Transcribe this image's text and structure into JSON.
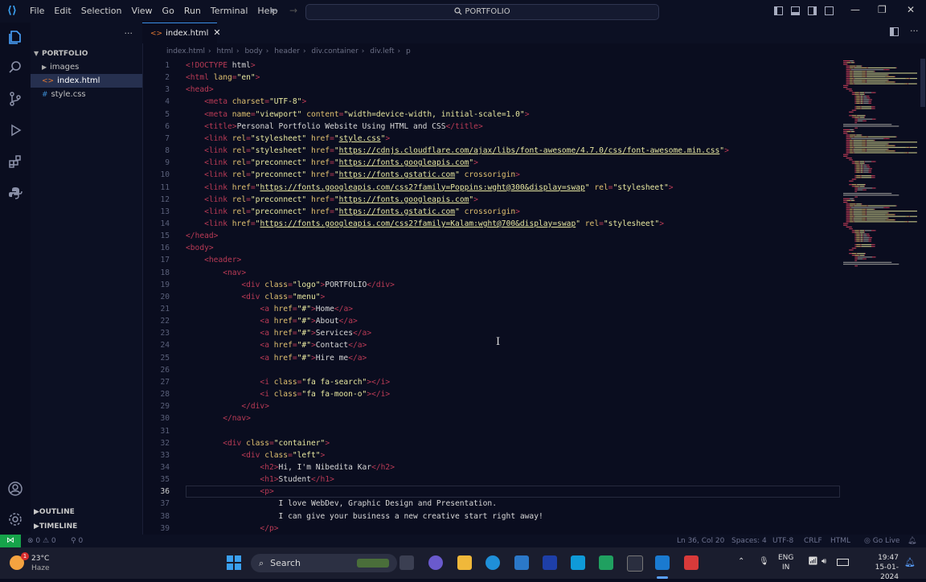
{
  "title_bar": {
    "menu": [
      "File",
      "Edit",
      "Selection",
      "View",
      "Go",
      "Run",
      "Terminal",
      "Help"
    ],
    "command_center": "PORTFOLIO"
  },
  "sidebar": {
    "explorer_root": "PORTFOLIO",
    "items": [
      {
        "label": "images",
        "type": "folder"
      },
      {
        "label": "index.html",
        "type": "html"
      },
      {
        "label": "style.css",
        "type": "css"
      }
    ],
    "outline": "OUTLINE",
    "timeline": "TIMELINE"
  },
  "editor": {
    "tab": "index.html",
    "breadcrumbs": [
      "index.html",
      "html",
      "body",
      "header",
      "div.container",
      "div.left",
      "p"
    ],
    "current_line": 36,
    "lines": [
      [
        [
          "t",
          "<!"
        ],
        [
          "k",
          "DOCTYPE"
        ],
        [
          "x",
          " html"
        ],
        [
          "t",
          ">"
        ]
      ],
      [
        [
          "t",
          "<"
        ],
        [
          "k",
          "html"
        ],
        [
          "a",
          " lang"
        ],
        [
          "t",
          "="
        ],
        [
          "v",
          "\"en\""
        ],
        [
          "t",
          ">"
        ]
      ],
      [
        [
          "t",
          "<"
        ],
        [
          "k",
          "head"
        ],
        [
          "t",
          ">"
        ]
      ],
      [
        [
          "x",
          "    "
        ],
        [
          "t",
          "<"
        ],
        [
          "k",
          "meta"
        ],
        [
          "a",
          " charset"
        ],
        [
          "t",
          "="
        ],
        [
          "v",
          "\"UTF-8\""
        ],
        [
          "t",
          ">"
        ]
      ],
      [
        [
          "x",
          "    "
        ],
        [
          "t",
          "<"
        ],
        [
          "k",
          "meta"
        ],
        [
          "a",
          " name"
        ],
        [
          "t",
          "="
        ],
        [
          "v",
          "\"viewport\""
        ],
        [
          "a",
          " content"
        ],
        [
          "t",
          "="
        ],
        [
          "v",
          "\"width=device-width, initial-scale=1.0\""
        ],
        [
          "t",
          ">"
        ]
      ],
      [
        [
          "x",
          "    "
        ],
        [
          "t",
          "<"
        ],
        [
          "k",
          "title"
        ],
        [
          "t",
          ">"
        ],
        [
          "x",
          "Personal Portfolio Website Using HTML and CSS"
        ],
        [
          "t",
          "</"
        ],
        [
          "k",
          "title"
        ],
        [
          "t",
          ">"
        ]
      ],
      [
        [
          "x",
          "    "
        ],
        [
          "t",
          "<"
        ],
        [
          "k",
          "link"
        ],
        [
          "a",
          " rel"
        ],
        [
          "t",
          "="
        ],
        [
          "v",
          "\"stylesheet\""
        ],
        [
          "a",
          " href"
        ],
        [
          "t",
          "="
        ],
        [
          "v",
          "\""
        ],
        [
          "l",
          "style.css"
        ],
        [
          "v",
          "\""
        ],
        [
          "t",
          ">"
        ]
      ],
      [
        [
          "x",
          "    "
        ],
        [
          "t",
          "<"
        ],
        [
          "k",
          "link"
        ],
        [
          "a",
          " rel"
        ],
        [
          "t",
          "="
        ],
        [
          "v",
          "\"stylesheet\""
        ],
        [
          "a",
          " href"
        ],
        [
          "t",
          "="
        ],
        [
          "v",
          "\""
        ],
        [
          "l",
          "https://cdnjs.cloudflare.com/ajax/libs/font-awesome/4.7.0/css/font-awesome.min.css"
        ],
        [
          "v",
          "\""
        ],
        [
          "t",
          ">"
        ]
      ],
      [
        [
          "x",
          "    "
        ],
        [
          "t",
          "<"
        ],
        [
          "k",
          "link"
        ],
        [
          "a",
          " rel"
        ],
        [
          "t",
          "="
        ],
        [
          "v",
          "\"preconnect\""
        ],
        [
          "a",
          " href"
        ],
        [
          "t",
          "="
        ],
        [
          "v",
          "\""
        ],
        [
          "l",
          "https://fonts.googleapis.com"
        ],
        [
          "v",
          "\""
        ],
        [
          "t",
          ">"
        ]
      ],
      [
        [
          "x",
          "    "
        ],
        [
          "t",
          "<"
        ],
        [
          "k",
          "link"
        ],
        [
          "a",
          " rel"
        ],
        [
          "t",
          "="
        ],
        [
          "v",
          "\"preconnect\""
        ],
        [
          "a",
          " href"
        ],
        [
          "t",
          "="
        ],
        [
          "v",
          "\""
        ],
        [
          "l",
          "https://fonts.gstatic.com"
        ],
        [
          "v",
          "\""
        ],
        [
          "a",
          " crossorigin"
        ],
        [
          "t",
          ">"
        ]
      ],
      [
        [
          "x",
          "    "
        ],
        [
          "t",
          "<"
        ],
        [
          "k",
          "link"
        ],
        [
          "a",
          " href"
        ],
        [
          "t",
          "="
        ],
        [
          "v",
          "\""
        ],
        [
          "l",
          "https://fonts.googleapis.com/css2?family=Poppins:wght@300&display=swap"
        ],
        [
          "v",
          "\""
        ],
        [
          "a",
          " rel"
        ],
        [
          "t",
          "="
        ],
        [
          "v",
          "\"stylesheet\""
        ],
        [
          "t",
          ">"
        ]
      ],
      [
        [
          "x",
          "    "
        ],
        [
          "t",
          "<"
        ],
        [
          "k",
          "link"
        ],
        [
          "a",
          " rel"
        ],
        [
          "t",
          "="
        ],
        [
          "v",
          "\"preconnect\""
        ],
        [
          "a",
          " href"
        ],
        [
          "t",
          "="
        ],
        [
          "v",
          "\""
        ],
        [
          "l",
          "https://fonts.googleapis.com"
        ],
        [
          "v",
          "\""
        ],
        [
          "t",
          ">"
        ]
      ],
      [
        [
          "x",
          "    "
        ],
        [
          "t",
          "<"
        ],
        [
          "k",
          "link"
        ],
        [
          "a",
          " rel"
        ],
        [
          "t",
          "="
        ],
        [
          "v",
          "\"preconnect\""
        ],
        [
          "a",
          " href"
        ],
        [
          "t",
          "="
        ],
        [
          "v",
          "\""
        ],
        [
          "l",
          "https://fonts.gstatic.com"
        ],
        [
          "v",
          "\""
        ],
        [
          "a",
          " crossorigin"
        ],
        [
          "t",
          ">"
        ]
      ],
      [
        [
          "x",
          "    "
        ],
        [
          "t",
          "<"
        ],
        [
          "k",
          "link"
        ],
        [
          "a",
          " href"
        ],
        [
          "t",
          "="
        ],
        [
          "v",
          "\""
        ],
        [
          "l",
          "https://fonts.googleapis.com/css2?family=Kalam:wght@700&display=swap"
        ],
        [
          "v",
          "\""
        ],
        [
          "a",
          " rel"
        ],
        [
          "t",
          "="
        ],
        [
          "v",
          "\"stylesheet\""
        ],
        [
          "t",
          ">"
        ]
      ],
      [
        [
          "t",
          "</"
        ],
        [
          "k",
          "head"
        ],
        [
          "t",
          ">"
        ]
      ],
      [
        [
          "t",
          "<"
        ],
        [
          "k",
          "body"
        ],
        [
          "t",
          ">"
        ]
      ],
      [
        [
          "x",
          "    "
        ],
        [
          "t",
          "<"
        ],
        [
          "k",
          "header"
        ],
        [
          "t",
          ">"
        ]
      ],
      [
        [
          "x",
          "        "
        ],
        [
          "t",
          "<"
        ],
        [
          "k",
          "nav"
        ],
        [
          "t",
          ">"
        ]
      ],
      [
        [
          "x",
          "            "
        ],
        [
          "t",
          "<"
        ],
        [
          "k",
          "div"
        ],
        [
          "a",
          " class"
        ],
        [
          "t",
          "="
        ],
        [
          "v",
          "\"logo\""
        ],
        [
          "t",
          ">"
        ],
        [
          "x",
          "PORTFOLIO"
        ],
        [
          "t",
          "</"
        ],
        [
          "k",
          "div"
        ],
        [
          "t",
          ">"
        ]
      ],
      [
        [
          "x",
          "            "
        ],
        [
          "t",
          "<"
        ],
        [
          "k",
          "div"
        ],
        [
          "a",
          " class"
        ],
        [
          "t",
          "="
        ],
        [
          "v",
          "\"menu\""
        ],
        [
          "t",
          ">"
        ]
      ],
      [
        [
          "x",
          "                "
        ],
        [
          "t",
          "<"
        ],
        [
          "k",
          "a"
        ],
        [
          "a",
          " href"
        ],
        [
          "t",
          "="
        ],
        [
          "v",
          "\"#\""
        ],
        [
          "t",
          ">"
        ],
        [
          "x",
          "Home"
        ],
        [
          "t",
          "</"
        ],
        [
          "k",
          "a"
        ],
        [
          "t",
          ">"
        ]
      ],
      [
        [
          "x",
          "                "
        ],
        [
          "t",
          "<"
        ],
        [
          "k",
          "a"
        ],
        [
          "a",
          " href"
        ],
        [
          "t",
          "="
        ],
        [
          "v",
          "\"#\""
        ],
        [
          "t",
          ">"
        ],
        [
          "x",
          "About"
        ],
        [
          "t",
          "</"
        ],
        [
          "k",
          "a"
        ],
        [
          "t",
          ">"
        ]
      ],
      [
        [
          "x",
          "                "
        ],
        [
          "t",
          "<"
        ],
        [
          "k",
          "a"
        ],
        [
          "a",
          " href"
        ],
        [
          "t",
          "="
        ],
        [
          "v",
          "\"#\""
        ],
        [
          "t",
          ">"
        ],
        [
          "x",
          "Services"
        ],
        [
          "t",
          "</"
        ],
        [
          "k",
          "a"
        ],
        [
          "t",
          ">"
        ]
      ],
      [
        [
          "x",
          "                "
        ],
        [
          "t",
          "<"
        ],
        [
          "k",
          "a"
        ],
        [
          "a",
          " href"
        ],
        [
          "t",
          "="
        ],
        [
          "v",
          "\"#\""
        ],
        [
          "t",
          ">"
        ],
        [
          "x",
          "Contact"
        ],
        [
          "t",
          "</"
        ],
        [
          "k",
          "a"
        ],
        [
          "t",
          ">"
        ]
      ],
      [
        [
          "x",
          "                "
        ],
        [
          "t",
          "<"
        ],
        [
          "k",
          "a"
        ],
        [
          "a",
          " href"
        ],
        [
          "t",
          "="
        ],
        [
          "v",
          "\"#\""
        ],
        [
          "t",
          ">"
        ],
        [
          "x",
          "Hire me"
        ],
        [
          "t",
          "</"
        ],
        [
          "k",
          "a"
        ],
        [
          "t",
          ">"
        ]
      ],
      [],
      [
        [
          "x",
          "                "
        ],
        [
          "t",
          "<"
        ],
        [
          "k",
          "i"
        ],
        [
          "a",
          " class"
        ],
        [
          "t",
          "="
        ],
        [
          "v",
          "\"fa fa-search\""
        ],
        [
          "t",
          "></"
        ],
        [
          "k",
          "i"
        ],
        [
          "t",
          ">"
        ]
      ],
      [
        [
          "x",
          "                "
        ],
        [
          "t",
          "<"
        ],
        [
          "k",
          "i"
        ],
        [
          "a",
          " class"
        ],
        [
          "t",
          "="
        ],
        [
          "v",
          "\"fa fa-moon-o\""
        ],
        [
          "t",
          "></"
        ],
        [
          "k",
          "i"
        ],
        [
          "t",
          ">"
        ]
      ],
      [
        [
          "x",
          "            "
        ],
        [
          "t",
          "</"
        ],
        [
          "k",
          "div"
        ],
        [
          "t",
          ">"
        ]
      ],
      [
        [
          "x",
          "        "
        ],
        [
          "t",
          "</"
        ],
        [
          "k",
          "nav"
        ],
        [
          "t",
          ">"
        ]
      ],
      [],
      [
        [
          "x",
          "        "
        ],
        [
          "t",
          "<"
        ],
        [
          "k",
          "div"
        ],
        [
          "a",
          " class"
        ],
        [
          "t",
          "="
        ],
        [
          "v",
          "\"container\""
        ],
        [
          "t",
          ">"
        ]
      ],
      [
        [
          "x",
          "            "
        ],
        [
          "t",
          "<"
        ],
        [
          "k",
          "div"
        ],
        [
          "a",
          " class"
        ],
        [
          "t",
          "="
        ],
        [
          "v",
          "\"left\""
        ],
        [
          "t",
          ">"
        ]
      ],
      [
        [
          "x",
          "                "
        ],
        [
          "t",
          "<"
        ],
        [
          "k",
          "h2"
        ],
        [
          "t",
          ">"
        ],
        [
          "x",
          "Hi, I'm Nibedita Kar"
        ],
        [
          "t",
          "</"
        ],
        [
          "k",
          "h2"
        ],
        [
          "t",
          ">"
        ]
      ],
      [
        [
          "x",
          "                "
        ],
        [
          "t",
          "<"
        ],
        [
          "k",
          "h1"
        ],
        [
          "t",
          ">"
        ],
        [
          "x",
          "Student"
        ],
        [
          "t",
          "</"
        ],
        [
          "k",
          "h1"
        ],
        [
          "t",
          ">"
        ]
      ],
      [
        [
          "x",
          "                "
        ],
        [
          "t",
          "<"
        ],
        [
          "k",
          "p"
        ],
        [
          "t",
          ">"
        ]
      ],
      [
        [
          "x",
          "                    I love WebDev, Graphic Design and Presentation."
        ]
      ],
      [
        [
          "x",
          "                    I can give your business a new creative start right away!"
        ]
      ],
      [
        [
          "x",
          "                "
        ],
        [
          "t",
          "</"
        ],
        [
          "k",
          "p"
        ],
        [
          "t",
          ">"
        ]
      ]
    ]
  },
  "status_bar": {
    "remote_icon": "remote-icon",
    "problems": "0 ⚠ 0",
    "ports": "0",
    "position": "Ln 36, Col 20",
    "spaces": "Spaces: 4",
    "encoding": "UTF-8",
    "eol": "CRLF",
    "language": "HTML",
    "go_live": "Go Live"
  },
  "taskbar": {
    "weather_badge": "1",
    "temperature": "23°C",
    "condition": "Haze",
    "search_placeholder": "Search",
    "lang_top": "ENG",
    "lang_bottom": "IN",
    "time": "19:47",
    "date": "15-01-2024"
  }
}
